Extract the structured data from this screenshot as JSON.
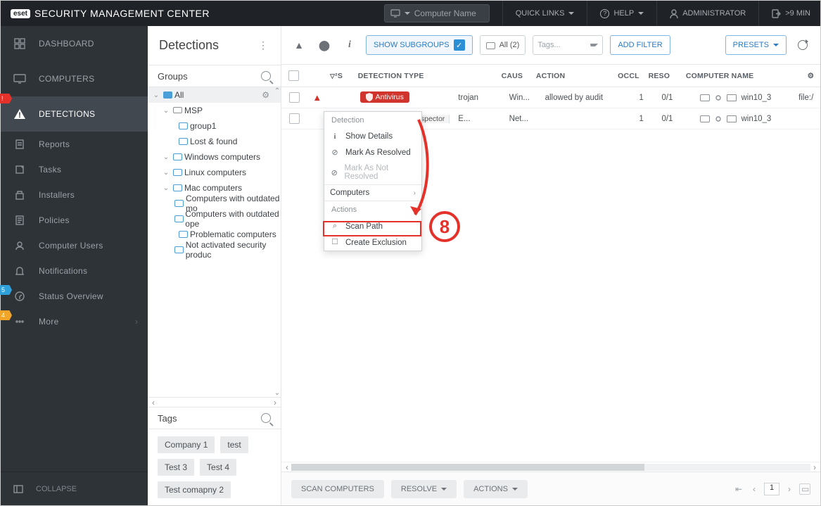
{
  "topbar": {
    "brand_badge": "eset",
    "brand_text": "SECURITY MANAGEMENT CENTER",
    "search_placeholder": "Computer Name",
    "quick_links": "QUICK LINKS",
    "help": "HELP",
    "administrator": "ADMINISTRATOR",
    "timeout": ">9 MIN"
  },
  "sidebar": {
    "dashboard": "DASHBOARD",
    "computers": "COMPUTERS",
    "detections": "DETECTIONS",
    "detections_notch": "!",
    "reports": "Reports",
    "tasks": "Tasks",
    "installers": "Installers",
    "policies": "Policies",
    "computer_users": "Computer Users",
    "notifications": "Notifications",
    "status_overview": "Status Overview",
    "status_notch": "5",
    "more": "More",
    "more_notch": "4",
    "collapse": "COLLAPSE"
  },
  "groups": {
    "page_title": "Detections",
    "section": "Groups",
    "tree": {
      "all": "All",
      "msp": "MSP",
      "group1": "group1",
      "lost_found": "Lost & found",
      "windows": "Windows computers",
      "linux": "Linux computers",
      "mac": "Mac computers",
      "outdated_mod": "Computers with outdated mo",
      "outdated_ope": "Computers with outdated ope",
      "problematic": "Problematic computers",
      "not_activated": "Not activated security produc"
    },
    "tags_section": "Tags",
    "tags": [
      "Company 1",
      "test",
      "Test 3",
      "Test 4",
      "Test comapny 2"
    ]
  },
  "toolbar": {
    "show_subgroups": "SHOW SUBGROUPS",
    "all_filter": "All (2)",
    "tags_placeholder": "Tags...",
    "add_filter": "ADD FILTER",
    "presets": "PRESETS"
  },
  "grid": {
    "headers": {
      "time_sort": "²S",
      "detection_type": "DETECTION TYPE",
      "cause": "CAUS",
      "action": "ACTION",
      "occurred": "OCCL",
      "resolved": "RESO",
      "computer_name": "COMPUTER NAME"
    },
    "rows": [
      {
        "badge_type": "av",
        "badge": "Antivirus",
        "desc": "trojan",
        "cause": "Win...",
        "action": "allowed by audit",
        "occurred": "1",
        "resolved": "0/1",
        "computer": "win10_3",
        "object": "file:/"
      },
      {
        "badge_type": "insp",
        "badge": "spector",
        "desc": "E...",
        "cause": "Net...",
        "action": "",
        "occurred": "1",
        "resolved": "0/1",
        "computer": "win10_3",
        "object": ""
      }
    ]
  },
  "context_menu": {
    "detection": "Detection",
    "show_details": "Show Details",
    "mark_resolved": "Mark As Resolved",
    "mark_not_resolved": "Mark As Not Resolved",
    "computers": "Computers",
    "actions": "Actions",
    "scan_path": "Scan Path",
    "create_exclusion": "Create Exclusion"
  },
  "callout": {
    "number": "8"
  },
  "bottom": {
    "scan_computers": "SCAN COMPUTERS",
    "resolve": "RESOLVE",
    "actions": "ACTIONS",
    "page": "1"
  }
}
